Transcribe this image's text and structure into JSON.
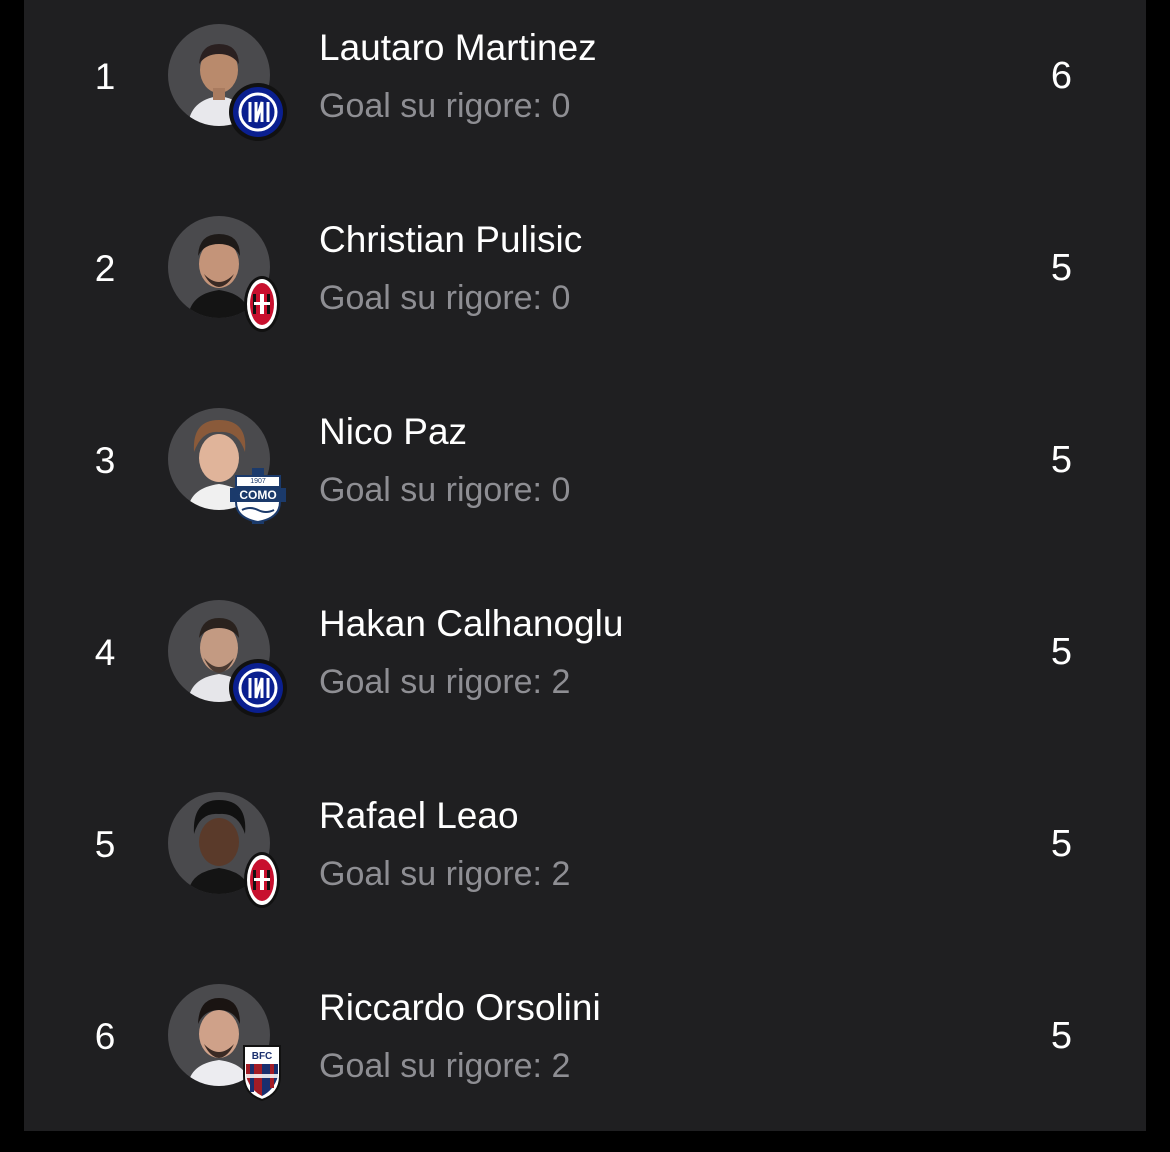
{
  "leaderboard": {
    "rows": [
      {
        "rank": "1",
        "name": "Lautaro Martinez",
        "penalties_label": "Goal su rigore: 0",
        "goals": "6",
        "club": "Inter",
        "club_icon": "inter-crest-icon"
      },
      {
        "rank": "2",
        "name": "Christian Pulisic",
        "penalties_label": "Goal su rigore: 0",
        "goals": "5",
        "club": "AC Milan",
        "club_icon": "milan-crest-icon"
      },
      {
        "rank": "3",
        "name": "Nico Paz",
        "penalties_label": "Goal su rigore: 0",
        "goals": "5",
        "club": "Como",
        "club_icon": "como-crest-icon"
      },
      {
        "rank": "4",
        "name": "Hakan Calhanoglu",
        "penalties_label": "Goal su rigore: 2",
        "goals": "5",
        "club": "Inter",
        "club_icon": "inter-crest-icon"
      },
      {
        "rank": "5",
        "name": "Rafael Leao",
        "penalties_label": "Goal su rigore: 2",
        "goals": "5",
        "club": "AC Milan",
        "club_icon": "milan-crest-icon"
      },
      {
        "rank": "6",
        "name": "Riccardo Orsolini",
        "penalties_label": "Goal su rigore: 2",
        "goals": "5",
        "club": "Bologna",
        "club_icon": "bologna-crest-icon"
      }
    ]
  },
  "colors": {
    "background": "#000000",
    "card": "#1f1f21",
    "primary_text": "#ffffff",
    "secondary_text": "#8e8e93",
    "avatar_bg": "#4a4a4d",
    "inter_blue": "#0a1f8f",
    "milan_red": "#c8102e",
    "como_blue": "#1b3a6b",
    "bologna_red": "#a21c26",
    "bologna_blue": "#1a2f6e"
  }
}
